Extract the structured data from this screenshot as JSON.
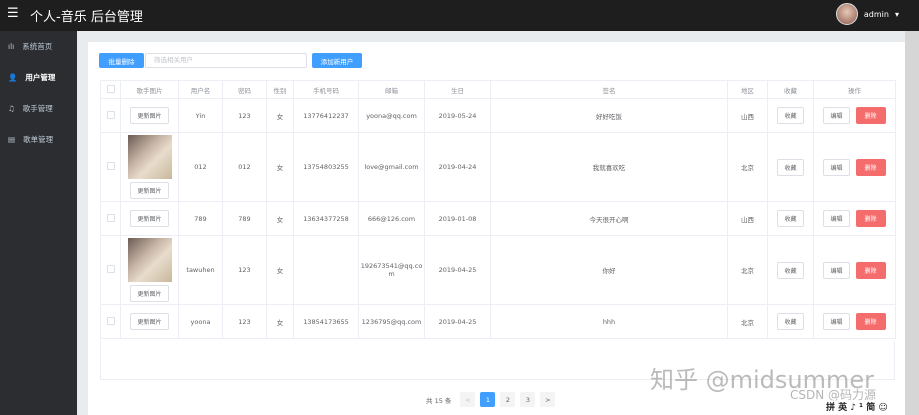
{
  "header": {
    "title": "个人-音乐 后台管理",
    "user": "admin"
  },
  "sidebar": {
    "items": [
      {
        "label": "系统首页",
        "icon": "bar-chart-icon"
      },
      {
        "label": "用户管理",
        "icon": "user-icon",
        "active": true
      },
      {
        "label": "歌手管理",
        "icon": "headset-icon"
      },
      {
        "label": "歌单管理",
        "icon": "document-icon"
      }
    ]
  },
  "toolbar": {
    "batch_delete": "批量删除",
    "search_placeholder": "筛选相关用户",
    "add_user": "添加新用户"
  },
  "table": {
    "headers": [
      "",
      "歌手图片",
      "用户名",
      "密码",
      "性别",
      "手机号码",
      "邮箱",
      "生日",
      "签名",
      "地区",
      "收藏",
      "操作"
    ],
    "update_pic": "更新图片",
    "collect": "收藏",
    "edit": "编辑",
    "delete": "删除",
    "rows": [
      {
        "has_pic": false,
        "username": "Yin",
        "password": "123",
        "gender": "女",
        "phone": "13776412237",
        "email": "yoona@qq.com",
        "birthday": "2019-05-24",
        "signature": "好好吃饭",
        "region": "山西"
      },
      {
        "has_pic": true,
        "username": "012",
        "password": "012",
        "gender": "女",
        "phone": "13754803255",
        "email": "love@gmail.com",
        "birthday": "2019-04-24",
        "signature": "我就喜欢吃",
        "region": "北京"
      },
      {
        "has_pic": false,
        "username": "789",
        "password": "789",
        "gender": "女",
        "phone": "13634377258",
        "email": "666@126.com",
        "birthday": "2019-01-08",
        "signature": "今天很开心啊",
        "region": "山西"
      },
      {
        "has_pic": true,
        "username": "tawuhen",
        "password": "123",
        "gender": "女",
        "phone": "",
        "email": "192673541@qq.com",
        "birthday": "2019-04-25",
        "signature": "你好",
        "region": "北京"
      },
      {
        "has_pic": false,
        "username": "yoona",
        "password": "123",
        "gender": "女",
        "phone": "13854173655",
        "email": "1236795@qq.com",
        "birthday": "2019-04-25",
        "signature": "hhh",
        "region": "北京"
      }
    ]
  },
  "pagination": {
    "total": "共 15 条",
    "prev": "<",
    "pages": [
      "1",
      "2",
      "3"
    ],
    "current": "1",
    "next": ">"
  },
  "watermark": {
    "zhihu": "知乎 @midsummer",
    "csdn": "CSDN @码力源",
    "taskbar": "拼 英 ♪ ¹ 简 ☺"
  }
}
